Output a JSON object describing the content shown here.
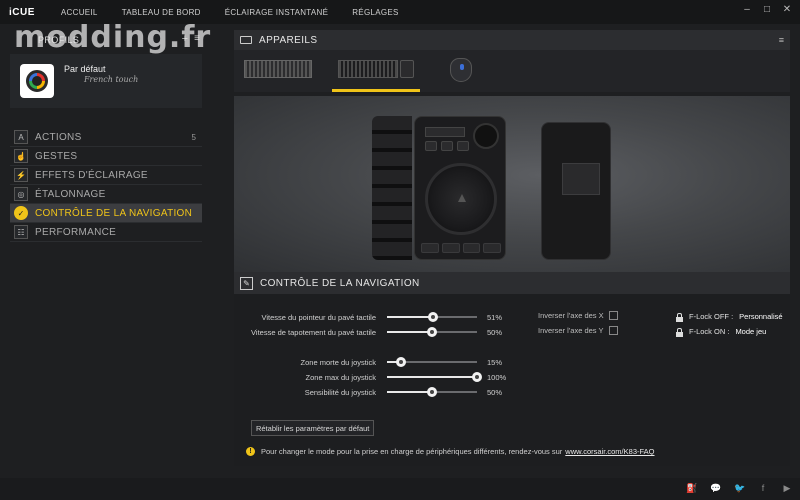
{
  "app": {
    "brand": "iCUE",
    "nav": [
      "ACCUEIL",
      "TABLEAU DE BORD",
      "ÉCLAIRAGE INSTANTANÉ",
      "RÉGLAGES"
    ],
    "watermark": "modding.fr"
  },
  "window_controls": {
    "minimize": "–",
    "maximize": "□",
    "close": "✕"
  },
  "profiles": {
    "title": "PROFILS",
    "add": "+",
    "menu": "≡",
    "current": {
      "name": "Par défaut",
      "subtitle": "French touch"
    }
  },
  "menu": [
    {
      "label": "ACTIONS",
      "icon": "A",
      "count": "5",
      "active": false
    },
    {
      "label": "GESTES",
      "icon": "☝",
      "count": "",
      "active": false
    },
    {
      "label": "EFFETS D'ÉCLAIRAGE",
      "icon": "⚡",
      "count": "",
      "active": false
    },
    {
      "label": "ÉTALONNAGE",
      "icon": "◎",
      "count": "",
      "active": false
    },
    {
      "label": "CONTRÔLE DE LA NAVIGATION",
      "icon": "✓",
      "count": "",
      "active": true
    },
    {
      "label": "PERFORMANCE",
      "icon": "☷",
      "count": "",
      "active": false
    }
  ],
  "devices": {
    "title": "APPAREILS",
    "menu": "≡"
  },
  "nav_control": {
    "title": "CONTRÔLE DE LA NAVIGATION",
    "sliders": [
      {
        "label": "Vitesse du pointeur du pavé tactile",
        "value": "51%",
        "level": 51
      },
      {
        "label": "Vitesse de tapotement du pavé tactile",
        "value": "50%",
        "level": 50
      },
      {
        "label": "Zone morte du joystick",
        "value": "15%",
        "level": 15
      },
      {
        "label": "Zone max du joystick",
        "value": "100%",
        "level": 100
      },
      {
        "label": "Sensibilité du joystick",
        "value": "50%",
        "level": 50
      }
    ],
    "invert_x": "Inverser l'axe des X",
    "invert_y": "Inverser l'axe des Y",
    "flock_off_label": "F-Lock OFF :",
    "flock_off_value": "Personnalisé",
    "flock_on_label": "F-Lock ON :",
    "flock_on_value": "Mode jeu",
    "reset": "Rétablir les paramètres par défaut",
    "info_text": "Pour changer le mode pour la prise en charge de périphériques différents, rendez-vous sur",
    "info_link": "www.corsair.com/K83-FAQ",
    "info_icon": "!"
  },
  "footer": {
    "icons": [
      "⛽",
      "💬",
      "🐦",
      "f",
      "▶"
    ]
  },
  "colors": {
    "accent": "#f0c419",
    "bg": "#1e1f21"
  }
}
